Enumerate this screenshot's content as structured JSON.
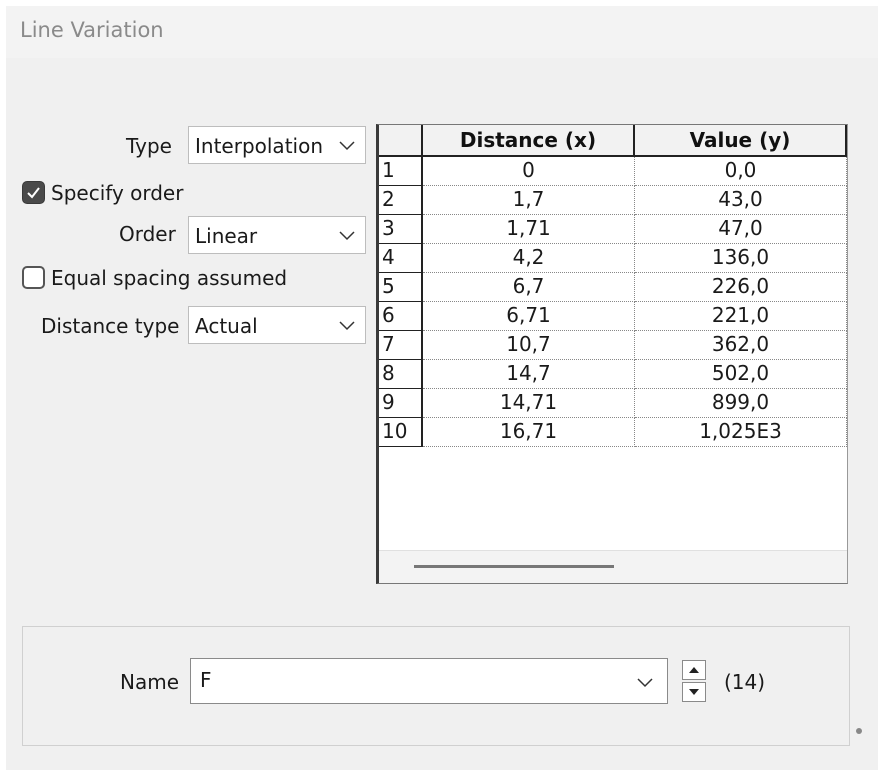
{
  "window": {
    "title": "Line Variation"
  },
  "form": {
    "type_label": "Type",
    "type_value": "Interpolation",
    "specify_order_label": "Specify order",
    "specify_order_checked": true,
    "order_label": "Order",
    "order_value": "Linear",
    "equal_spacing_label": "Equal spacing assumed",
    "equal_spacing_checked": false,
    "distance_type_label": "Distance type",
    "distance_type_value": "Actual"
  },
  "table": {
    "headers": [
      "Distance (x)",
      "Value (y)"
    ],
    "rows": [
      {
        "n": "1",
        "x": "0",
        "y": "0,0"
      },
      {
        "n": "2",
        "x": "1,7",
        "y": "43,0"
      },
      {
        "n": "3",
        "x": "1,71",
        "y": "47,0"
      },
      {
        "n": "4",
        "x": "4,2",
        "y": "136,0"
      },
      {
        "n": "5",
        "x": "6,7",
        "y": "226,0"
      },
      {
        "n": "6",
        "x": "6,71",
        "y": "221,0"
      },
      {
        "n": "7",
        "x": "10,7",
        "y": "362,0"
      },
      {
        "n": "8",
        "x": "14,7",
        "y": "502,0"
      },
      {
        "n": "9",
        "x": "14,71",
        "y": "899,0"
      },
      {
        "n": "10",
        "x": "16,71",
        "y": "1,025E3"
      }
    ]
  },
  "name_section": {
    "label": "Name",
    "value": "F",
    "count": "(14)"
  },
  "icons": {
    "dropdown": "chevron-down-icon",
    "check": "checkmark-icon",
    "spin_up": "arrow-up-icon",
    "spin_down": "arrow-down-icon"
  }
}
